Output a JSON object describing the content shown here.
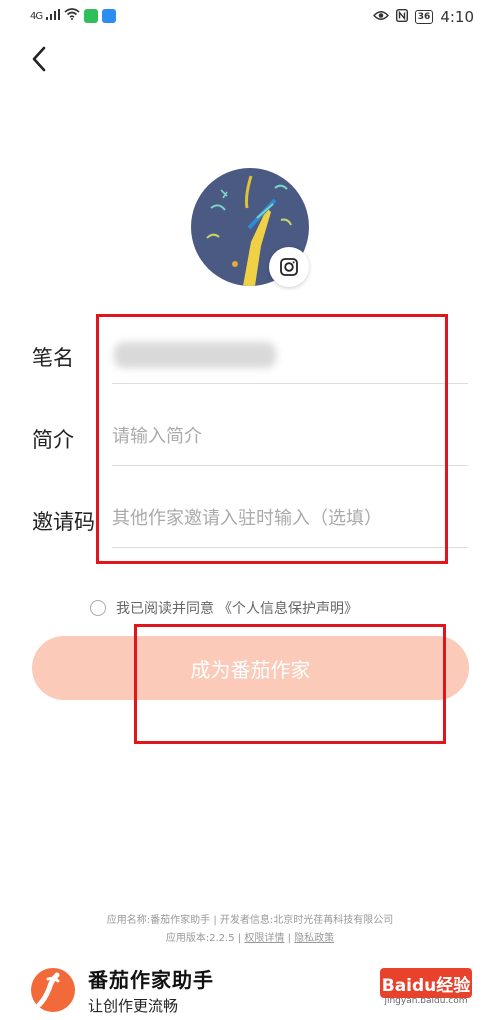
{
  "status_bar": {
    "network": "4G",
    "battery": "36",
    "time": "4:10"
  },
  "form": {
    "pen_name_label": "笔名",
    "intro_label": "简介",
    "intro_placeholder": "请输入简介",
    "invite_label": "邀请码",
    "invite_placeholder": "其他作家邀请入驻时输入（选填）"
  },
  "agreement": {
    "text": "我已阅读并同意",
    "link": "《个人信息保护声明》"
  },
  "submit_label": "成为番茄作家",
  "footer": {
    "app_info": "应用名称:番茄作家助手 | 开发者信息:北京时光荏苒科技有限公司",
    "version": "应用版本:2.2.5 |",
    "permissions_link": "权限详情",
    "separator": "|",
    "privacy_link": "隐私政策"
  },
  "brand": {
    "name": "番茄作家助手",
    "slogan": "让创作更流畅"
  },
  "watermark": {
    "logo": "Baidu经验",
    "url": "jingyan.baidu.com"
  },
  "colors": {
    "accent": "#f26a3a",
    "button": "#fbcab8",
    "highlight": "#e0161c"
  }
}
